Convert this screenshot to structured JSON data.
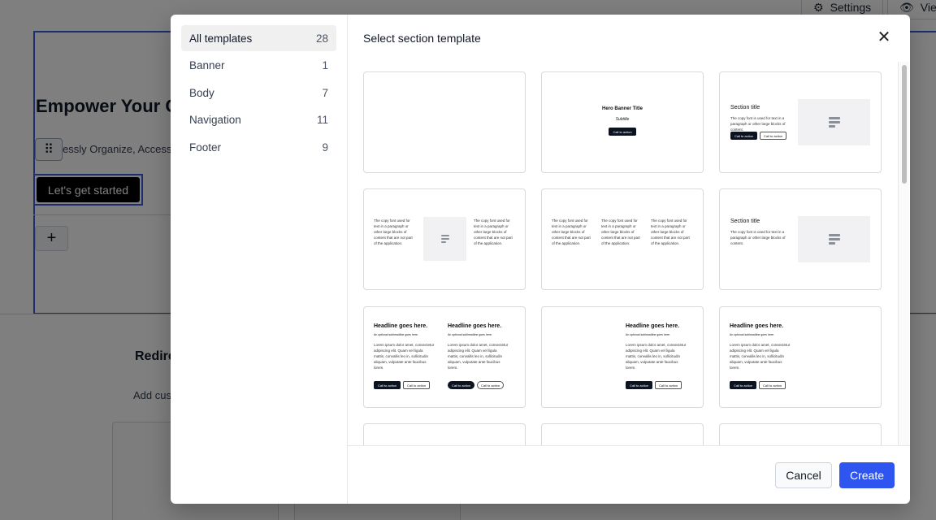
{
  "background": {
    "toolbar": {
      "settings_label": "Settings",
      "view_label": "View"
    },
    "hero": {
      "title": "Empower Your Cr",
      "subtitle": "essly Organize, Access, an",
      "cta_label": "Let's get started"
    },
    "add_icon": "plus-icon",
    "redirect": {
      "title": "Redire",
      "desc": "Add cust"
    }
  },
  "modal": {
    "title": "Select section template",
    "close_icon": "close-icon",
    "categories": [
      {
        "label": "All templates",
        "count": "28",
        "active": true
      },
      {
        "label": "Banner",
        "count": "1"
      },
      {
        "label": "Body",
        "count": "7"
      },
      {
        "label": "Navigation",
        "count": "11"
      },
      {
        "label": "Footer",
        "count": "9"
      }
    ],
    "cancel_label": "Cancel",
    "create_label": "Create",
    "thumbs": {
      "hero_title": "Hero Banner Title",
      "hero_subtitle": "Subtitle",
      "hero_button": "Call to action",
      "section_title": "Section title",
      "section_text": "The copy font is used for text in a paragraph or other large blocks of content.",
      "btn_dark": "Call to action",
      "btn_light": "Call to action",
      "col_text": "The copy font used for text in a paragraph or other large blocks of content that are not part of the application.",
      "headline": "Headline goes here.",
      "headline_sub": "An optional subheadline goes here.",
      "lorem": "Lorem ipsum dolor amet, consectetur adipiscing elit. Quam vel ligula mattis, convallis leo in, sollicitudin aliquam, vulputate ante faucibus lorem."
    }
  },
  "colors": {
    "accent": "#2f55f0",
    "selection": "#3b5bdb",
    "dark_button": "#0b1220"
  }
}
